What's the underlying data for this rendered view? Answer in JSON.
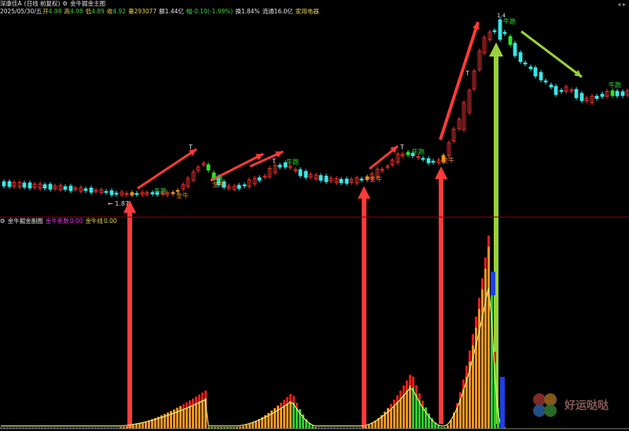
{
  "header": {
    "title": "深康佳A",
    "period": "(日线 前复权)",
    "indicator": "金牛掘金主图",
    "date": "2025/05/30/五",
    "open_label": "开",
    "open": "4.98",
    "high_label": "高",
    "high": "4.98",
    "low_label": "低",
    "low": "4.89",
    "close_label": "收",
    "close": "4.92",
    "volume_label": "量",
    "volume": "293077",
    "amount_label": "额",
    "amount": "1.44亿",
    "change_label": "幅",
    "change": "-0.10(-1.99%)",
    "turnover_label": "换",
    "turnover": "1.84%",
    "float_label": "流通",
    "float_cap": "16.0亿",
    "sector": "家用电器"
  },
  "sub": {
    "indicator": "金牛掘金副图",
    "coef_label": "金牛系数",
    "coef": "0.00",
    "line_label": "金牛线",
    "line": "0.00"
  },
  "annotations": {
    "low_price": "1.87",
    "high_price": "1.4",
    "gold_bull": "金牛",
    "bull_run": "牛跑",
    "t_mark": "T"
  },
  "watermark": "好运哒哒",
  "colors": {
    "up": "#ff3333",
    "down": "#39e6e6",
    "bull_bar": "#f09020",
    "bull_run_bar": "#2ee02e",
    "arrow_red": "#ff3a3a",
    "arrow_green": "#9ad13a",
    "sub_red": "#ee1c1c",
    "sub_orange": "#f29422",
    "sub_green": "#2ecc2e",
    "sub_blue": "#1f3fe6",
    "sub_line": "#f0ec7a"
  }
}
